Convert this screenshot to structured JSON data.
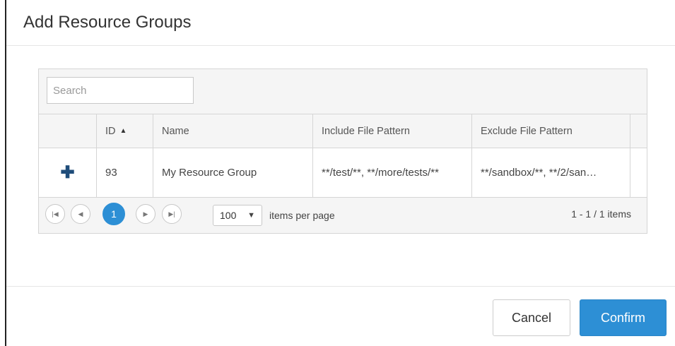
{
  "dialog": {
    "title": "Add Resource Groups"
  },
  "search": {
    "placeholder": "Search"
  },
  "table": {
    "columns": [
      "",
      "ID",
      "Name",
      "Include File Pattern",
      "Exclude File Pattern"
    ],
    "sort_indicator": "▲",
    "rows": [
      {
        "action_icon": "plus-icon",
        "id": "93",
        "name": "My Resource Group",
        "include": "**/test/**, **/more/tests/**",
        "exclude": "**/sandbox/**, **/2/san…"
      }
    ]
  },
  "pager": {
    "current_page": "1",
    "page_size": "100",
    "items_per_page_label": "items per page",
    "summary": "1 - 1 / 1 items"
  },
  "buttons": {
    "cancel": "Cancel",
    "confirm": "Confirm"
  },
  "colors": {
    "accent": "#2d8fd5",
    "plus_icon": "#1f4d7a",
    "header_bg": "#f5f5f5"
  }
}
